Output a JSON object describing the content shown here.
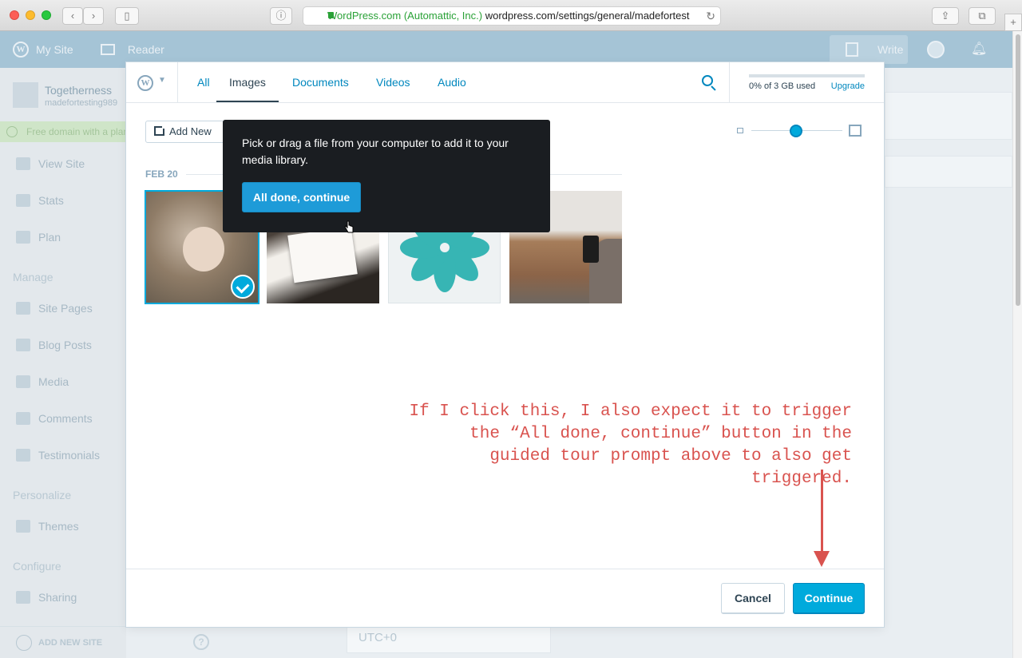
{
  "browser": {
    "url_secure_label": "WordPress.com (Automattic, Inc.)",
    "url_path": "wordpress.com/settings/general/madefortest"
  },
  "masterbar": {
    "my_site": "My Site",
    "reader": "Reader",
    "write": "Write"
  },
  "sidebar": {
    "site_name": "Togetherness",
    "site_url": "madefortesting989",
    "domain_banner": "Free domain with a plan",
    "items_top": [
      "View Site",
      "Stats",
      "Plan"
    ],
    "heading_manage": "Manage",
    "items_manage": [
      "Site Pages",
      "Blog Posts",
      "Media",
      "Comments",
      "Testimonials"
    ],
    "heading_personalize": "Personalize",
    "items_personalize": [
      "Themes"
    ],
    "heading_configure": "Configure",
    "items_configure": [
      "Sharing"
    ],
    "add_new_site": "ADD NEW SITE"
  },
  "background": {
    "timezone_value": "UTC+0",
    "help_icon": "?"
  },
  "modal": {
    "tabs": [
      "All",
      "Images",
      "Documents",
      "Videos",
      "Audio"
    ],
    "active_tab": "Images",
    "storage_text": "0% of 3 GB used",
    "upgrade": "Upgrade",
    "add_new": "Add New",
    "date_group": "FEB 20",
    "zoom_level": 0.5,
    "selected_image_index": 0,
    "cancel": "Cancel",
    "continue": "Continue"
  },
  "tooltip": {
    "text": "Pick or drag a file from your computer to add it to your media library.",
    "button": "All done, continue"
  },
  "annotation": {
    "line1": "If I click this, I also expect it to trigger",
    "line2": "the “All done, continue” button in the",
    "line3": "guided tour prompt above to also get triggered."
  },
  "colors": {
    "accent": "#00aadc",
    "annotation": "#d9534f",
    "tooltip_bg": "#1a1d21"
  }
}
